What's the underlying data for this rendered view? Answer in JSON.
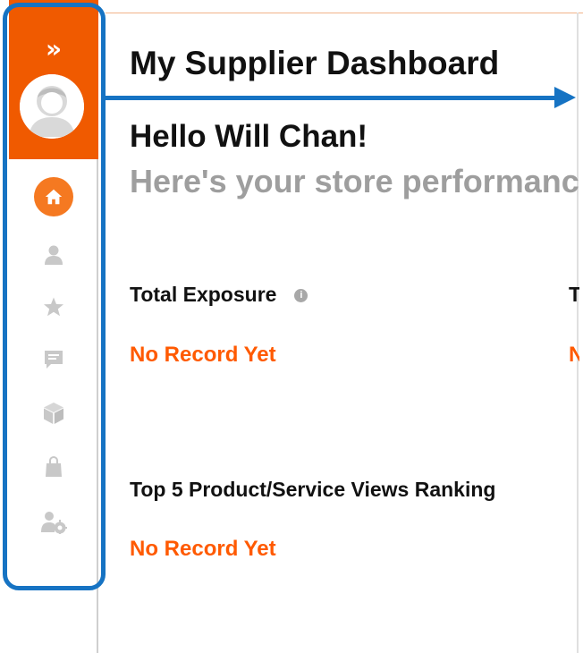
{
  "sidebar": {
    "expand_glyph": "»",
    "items": [
      {
        "name": "home",
        "icon": "home-icon",
        "active": true
      },
      {
        "name": "profile",
        "icon": "user-icon",
        "active": false
      },
      {
        "name": "favorites",
        "icon": "star-icon",
        "active": false
      },
      {
        "name": "messages",
        "icon": "chat-icon",
        "active": false
      },
      {
        "name": "products",
        "icon": "box-icon",
        "active": false
      },
      {
        "name": "orders",
        "icon": "bag-icon",
        "active": false
      },
      {
        "name": "account-settings",
        "icon": "user-gear-icon",
        "active": false
      }
    ]
  },
  "header": {
    "title": "My Supplier Dashboard"
  },
  "greeting": {
    "hello": "Hello Will Chan!",
    "subtitle": "Here's your store performance"
  },
  "stats": {
    "total_exposure": {
      "label": "Total Exposure",
      "value": "No Record Yet"
    },
    "second_card": {
      "label": "T",
      "value": "N"
    },
    "top5": {
      "label": "Top 5 Product/Service Views Ranking",
      "value": "No Record Yet"
    }
  },
  "colors": {
    "brand_orange": "#f05a00",
    "accent_orange": "#ff5a00",
    "annotation_blue": "#1673c3",
    "icon_gray": "#c8c8c8"
  }
}
